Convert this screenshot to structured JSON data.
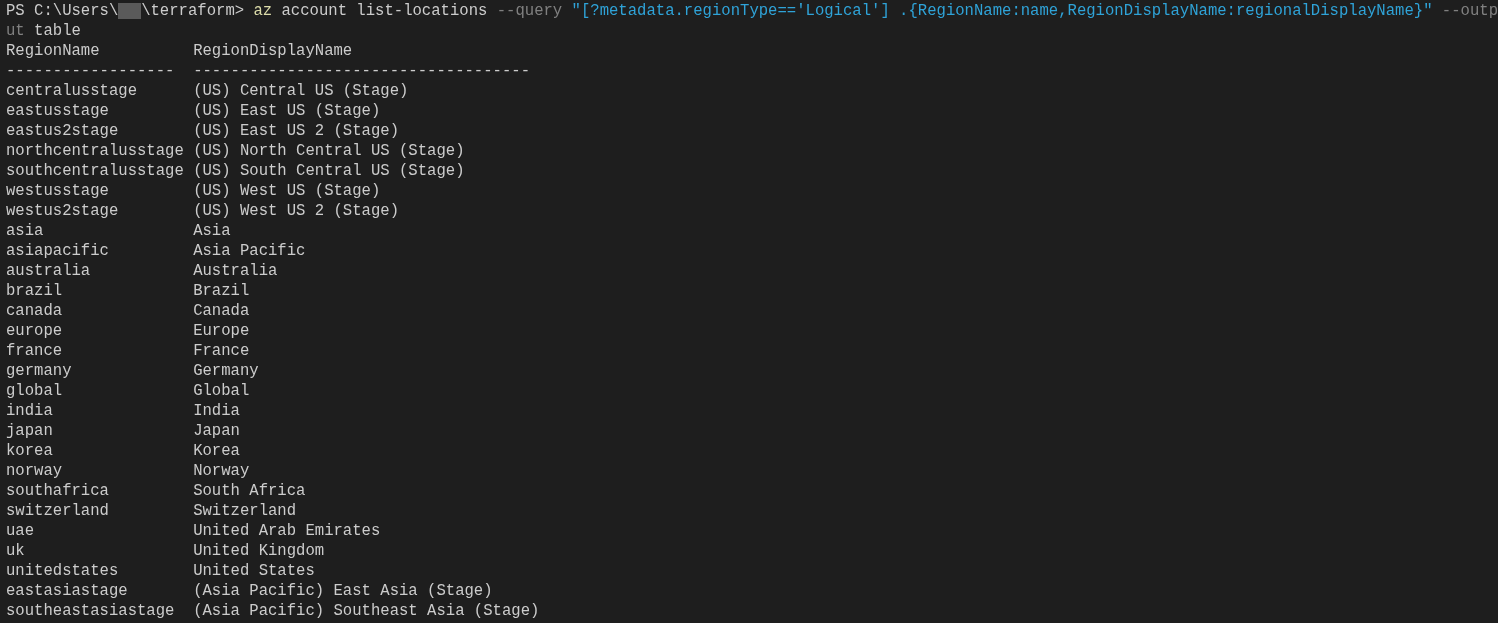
{
  "command_line": {
    "prompt_start": "PS C:\\Users\\",
    "username_redacted": true,
    "prompt_end": "\\terraform>",
    "tokens": [
      {
        "text": "az",
        "kind": "command"
      },
      {
        "text": "account list-locations",
        "kind": "arg"
      },
      {
        "text": "--query",
        "kind": "flag"
      },
      {
        "text": "\"[?metadata.regionType=='Logical'] .{RegionName:name,RegionDisplayName:regionalDisplayName}\"",
        "kind": "string"
      },
      {
        "text": "--outp",
        "kind": "flag"
      }
    ],
    "wrapped_tokens": [
      {
        "text": "ut",
        "kind": "flag"
      },
      {
        "text": "table",
        "kind": "arg"
      }
    ]
  },
  "table": {
    "columns": [
      "RegionName",
      "RegionDisplayName"
    ],
    "separators": [
      "------------------",
      "------------------------------------"
    ],
    "rows": [
      [
        "centralusstage",
        "(US) Central US (Stage)"
      ],
      [
        "eastusstage",
        "(US) East US (Stage)"
      ],
      [
        "eastus2stage",
        "(US) East US 2 (Stage)"
      ],
      [
        "northcentralusstage",
        "(US) North Central US (Stage)"
      ],
      [
        "southcentralusstage",
        "(US) South Central US (Stage)"
      ],
      [
        "westusstage",
        "(US) West US (Stage)"
      ],
      [
        "westus2stage",
        "(US) West US 2 (Stage)"
      ],
      [
        "asia",
        "Asia"
      ],
      [
        "asiapacific",
        "Asia Pacific"
      ],
      [
        "australia",
        "Australia"
      ],
      [
        "brazil",
        "Brazil"
      ],
      [
        "canada",
        "Canada"
      ],
      [
        "europe",
        "Europe"
      ],
      [
        "france",
        "France"
      ],
      [
        "germany",
        "Germany"
      ],
      [
        "global",
        "Global"
      ],
      [
        "india",
        "India"
      ],
      [
        "japan",
        "Japan"
      ],
      [
        "korea",
        "Korea"
      ],
      [
        "norway",
        "Norway"
      ],
      [
        "southafrica",
        "South Africa"
      ],
      [
        "switzerland",
        "Switzerland"
      ],
      [
        "uae",
        "United Arab Emirates"
      ],
      [
        "uk",
        "United Kingdom"
      ],
      [
        "unitedstates",
        "United States"
      ],
      [
        "eastasiastage",
        "(Asia Pacific) East Asia (Stage)"
      ],
      [
        "southeastasiastage",
        "(Asia Pacific) Southeast Asia (Stage)"
      ]
    ]
  }
}
